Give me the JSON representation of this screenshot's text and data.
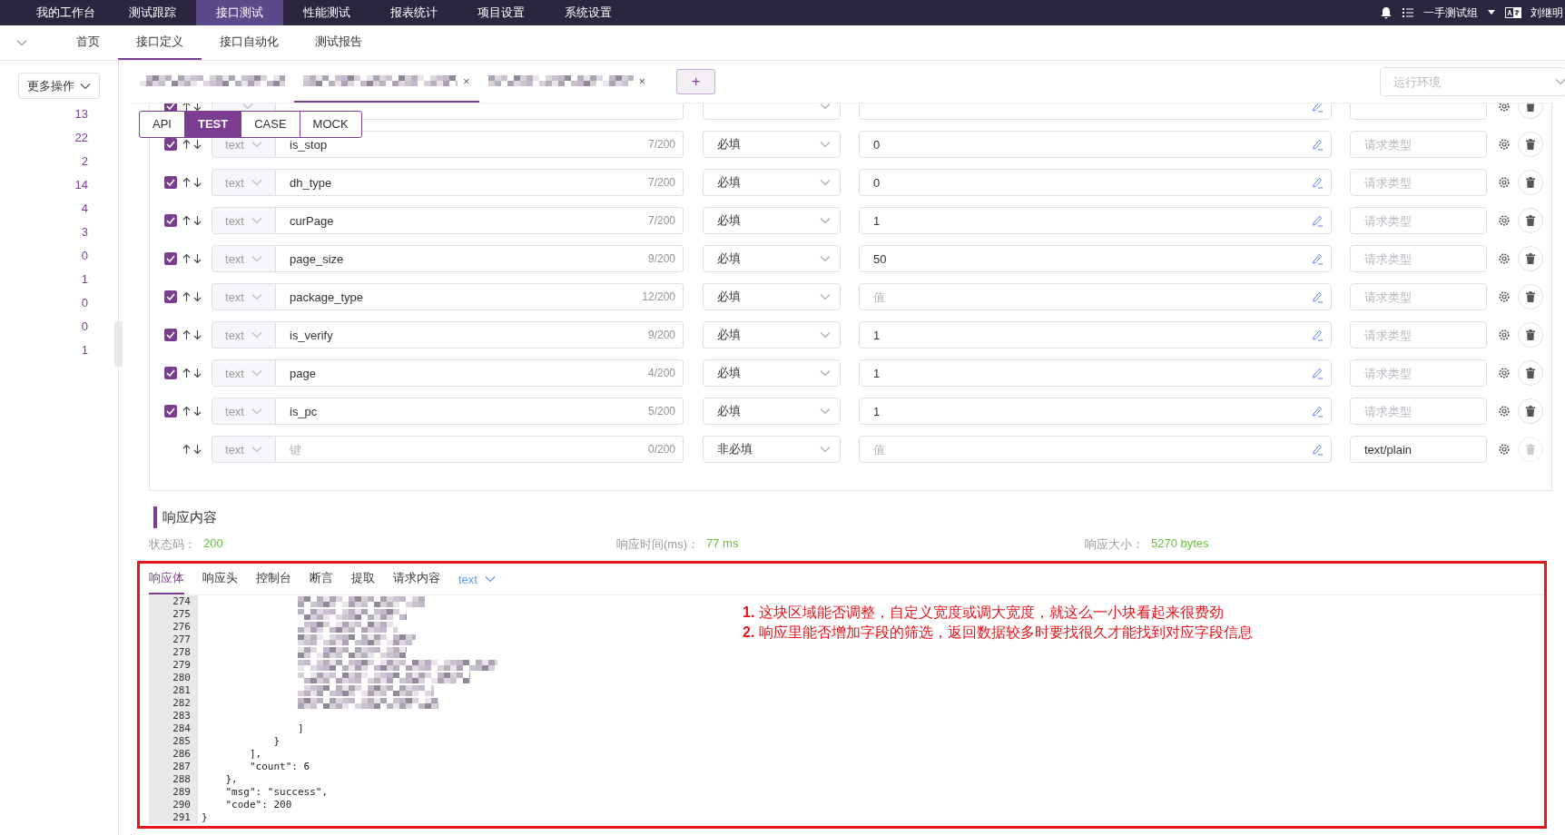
{
  "top_nav": {
    "items": [
      {
        "label": "我的工作台",
        "selected": false
      },
      {
        "label": "测试跟踪",
        "selected": false
      },
      {
        "label": "接口测试",
        "selected": true
      },
      {
        "label": "性能测试",
        "selected": false
      },
      {
        "label": "报表统计",
        "selected": false
      },
      {
        "label": "项目设置",
        "selected": false
      },
      {
        "label": "系统设置",
        "selected": false
      }
    ],
    "workspace": "一手测试组",
    "user": "刘继明"
  },
  "sub_nav": [
    {
      "label": "首页",
      "selected": false
    },
    {
      "label": "接口定义",
      "selected": true
    },
    {
      "label": "接口自动化",
      "selected": false
    },
    {
      "label": "测试报告",
      "selected": false
    }
  ],
  "sidebar": {
    "more_button": "更多操作",
    "counts": [
      "13",
      "22",
      "2",
      "14",
      "4",
      "3",
      "0",
      "1",
      "0",
      "0",
      "1"
    ]
  },
  "request_tabs": [
    {
      "selected": false
    },
    {
      "selected": true,
      "close": "×"
    },
    {
      "selected": false,
      "close": "×"
    }
  ],
  "add_tab": "+",
  "environment": {
    "placeholder": "运行环境"
  },
  "mode_tabs": [
    {
      "label": "API",
      "selected": false
    },
    {
      "label": "TEST",
      "selected": true
    },
    {
      "label": "CASE",
      "selected": false
    },
    {
      "label": "MOCK",
      "selected": false
    }
  ],
  "params": [
    {
      "kind": "param",
      "checked": true
    },
    {
      "kind": "param",
      "checked": true,
      "type": "text",
      "key": "is_stop",
      "count": "7/200",
      "required": "必填",
      "value": "0",
      "content_type_placeholder": "请求类型"
    },
    {
      "kind": "param",
      "checked": true,
      "type": "text",
      "key": "dh_type",
      "count": "7/200",
      "required": "必填",
      "value": "0",
      "content_type_placeholder": "请求类型"
    },
    {
      "kind": "param",
      "checked": true,
      "type": "text",
      "key": "curPage",
      "count": "7/200",
      "required": "必填",
      "value": "1",
      "content_type_placeholder": "请求类型"
    },
    {
      "kind": "param",
      "checked": true,
      "type": "text",
      "key": "page_size",
      "count": "9/200",
      "required": "必填",
      "value": "50",
      "content_type_placeholder": "请求类型"
    },
    {
      "kind": "param",
      "checked": true,
      "type": "text",
      "key": "package_type",
      "count": "12/200",
      "required": "必填",
      "value_placeholder": "值",
      "content_type_placeholder": "请求类型"
    },
    {
      "kind": "param",
      "checked": true,
      "type": "text",
      "key": "is_verify",
      "count": "9/200",
      "required": "必填",
      "value": "1",
      "content_type_placeholder": "请求类型"
    },
    {
      "kind": "param",
      "checked": true,
      "type": "text",
      "key": "page",
      "count": "4/200",
      "required": "必填",
      "value": "1",
      "content_type_placeholder": "请求类型"
    },
    {
      "kind": "param",
      "checked": true,
      "type": "text",
      "key": "is_pc",
      "count": "5/200",
      "required": "必填",
      "value": "1",
      "content_type_placeholder": "请求类型"
    },
    {
      "kind": "new",
      "type": "text",
      "key_placeholder": "键",
      "count": "0/200",
      "required": "非必填",
      "value_placeholder": "值",
      "content_type": "text/plain"
    }
  ],
  "response": {
    "title": "响应内容",
    "status_label": "状态码：",
    "status": "200",
    "time_label": "响应时间(ms)：",
    "time": "77 ms",
    "size_label": "响应大小：",
    "size": "5270 bytes",
    "tabs": [
      {
        "label": "响应体",
        "selected": true
      },
      {
        "label": "响应头",
        "selected": false
      },
      {
        "label": "控制台",
        "selected": false
      },
      {
        "label": "断言",
        "selected": false
      },
      {
        "label": "提取",
        "selected": false
      },
      {
        "label": "请求内容",
        "selected": false
      }
    ],
    "format": "text",
    "code_lines": [
      {
        "num": "274",
        "kind": "pixelated"
      },
      {
        "num": "275",
        "kind": "pixelated"
      },
      {
        "num": "276",
        "kind": "pixelated"
      },
      {
        "num": "277",
        "kind": "pixelated"
      },
      {
        "num": "278",
        "kind": "pixelated"
      },
      {
        "num": "279",
        "kind": "pixelated"
      },
      {
        "num": "280",
        "kind": "pixelated"
      },
      {
        "num": "281",
        "kind": "pixelated"
      },
      {
        "num": "282",
        "kind": "pixelated"
      },
      {
        "num": "283",
        "kind": "code"
      },
      {
        "num": "284",
        "kind": "code",
        "text": "                ]"
      },
      {
        "num": "285",
        "kind": "code",
        "text": "            }"
      },
      {
        "num": "286",
        "kind": "code",
        "text": "        ],"
      },
      {
        "num": "287",
        "kind": "code",
        "text": "        \"count\": 6"
      },
      {
        "num": "288",
        "kind": "code",
        "text": "    },"
      },
      {
        "num": "289",
        "kind": "code",
        "text": "    \"msg\": \"success\","
      },
      {
        "num": "290",
        "kind": "code",
        "text": "    \"code\": 200"
      },
      {
        "num": "291",
        "kind": "code",
        "text": "}"
      }
    ]
  },
  "annotations": [
    "**1.** 这块区域能否调整，自定义宽度或调大宽度，就这么一小块看起来很费劲",
    "**2.** 响应里能否增加字段的筛选，返回数据较多时要找很久才能找到对应字段信息"
  ]
}
